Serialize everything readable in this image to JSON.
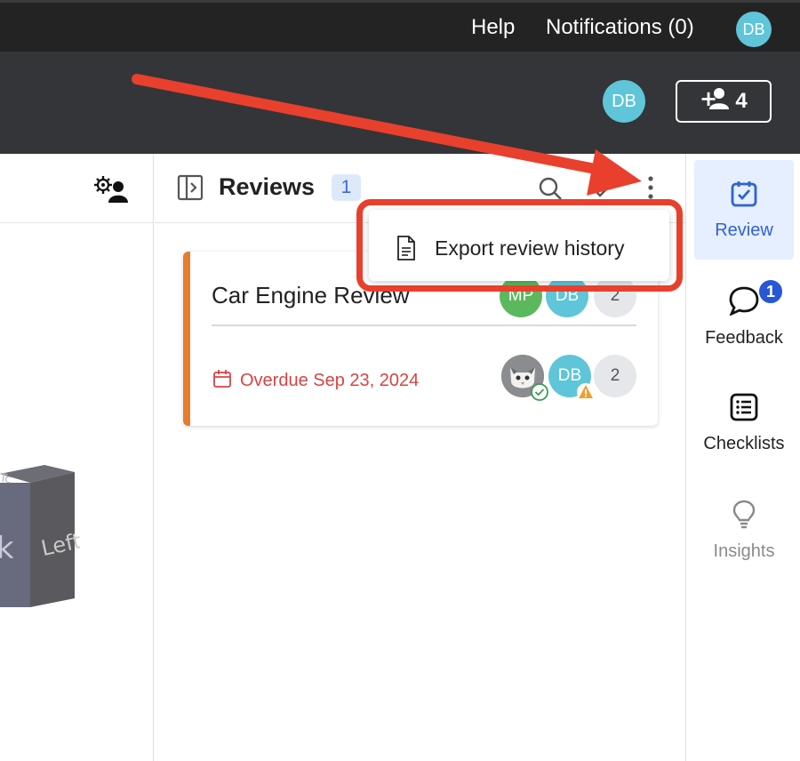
{
  "topbar": {
    "help_label": "Help",
    "notifications_label": "Notifications (0)",
    "user_initials": "DB"
  },
  "header": {
    "user_initials": "DB",
    "share_count": "4"
  },
  "reviews_panel": {
    "title": "Reviews",
    "count": "1"
  },
  "menu": {
    "export_label": "Export review history"
  },
  "review_card": {
    "title": "Car Engine Review",
    "due_text": "Overdue Sep 23, 2024",
    "assignees": [
      "MP",
      "DB"
    ],
    "assignee_extra": "2",
    "approvers": [
      "DB"
    ],
    "approver_extra": "2"
  },
  "rail": {
    "review_label": "Review",
    "feedback_label": "Feedback",
    "feedback_badge": "1",
    "checklists_label": "Checklists",
    "insights_label": "Insights"
  },
  "cube": {
    "left_face": "Left"
  },
  "colors": {
    "accent_blue": "#2f62d4",
    "overdue_red": "#d94343",
    "card_accent": "#e47d2e",
    "annotation_red": "#e8402c",
    "avatar_teal": "#5fc5d8",
    "avatar_green": "#5cb85c"
  }
}
